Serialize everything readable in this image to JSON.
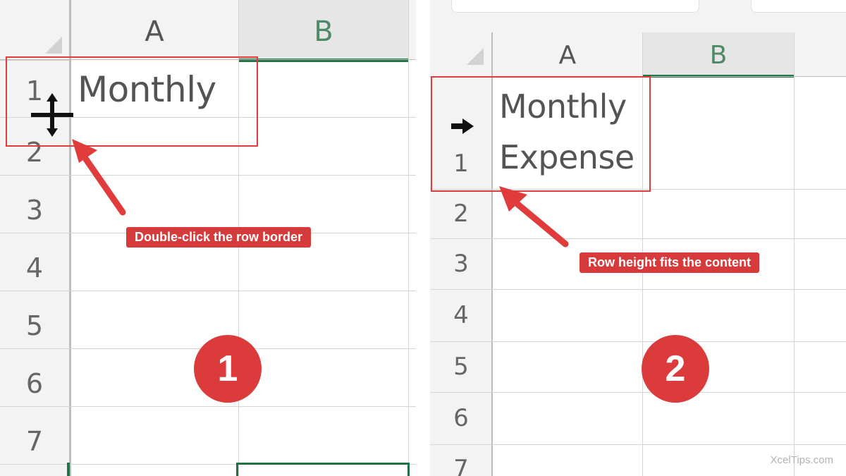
{
  "left": {
    "columns": [
      "A",
      "B"
    ],
    "rows": [
      "1",
      "2",
      "3",
      "4",
      "5",
      "6",
      "7"
    ],
    "cell_a1": "Monthly",
    "callout": "Double-click the row border",
    "step": "1"
  },
  "right": {
    "columns": [
      "A",
      "B"
    ],
    "rows": [
      "1",
      "2",
      "3",
      "4",
      "5",
      "6",
      "7"
    ],
    "cell_a1_line1": "Monthly",
    "cell_a1_line2": "Expense",
    "callout": "Row height fits the content",
    "step": "2"
  },
  "watermark": "XcelTips.com",
  "colors": {
    "accent_red": "#d63a3a",
    "excel_green": "#217346",
    "selected_column_text": "#4f8a66"
  },
  "icons": {
    "resize_cursor": "row-resize-cursor-icon",
    "row_select_arrow": "row-select-arrow-icon"
  }
}
